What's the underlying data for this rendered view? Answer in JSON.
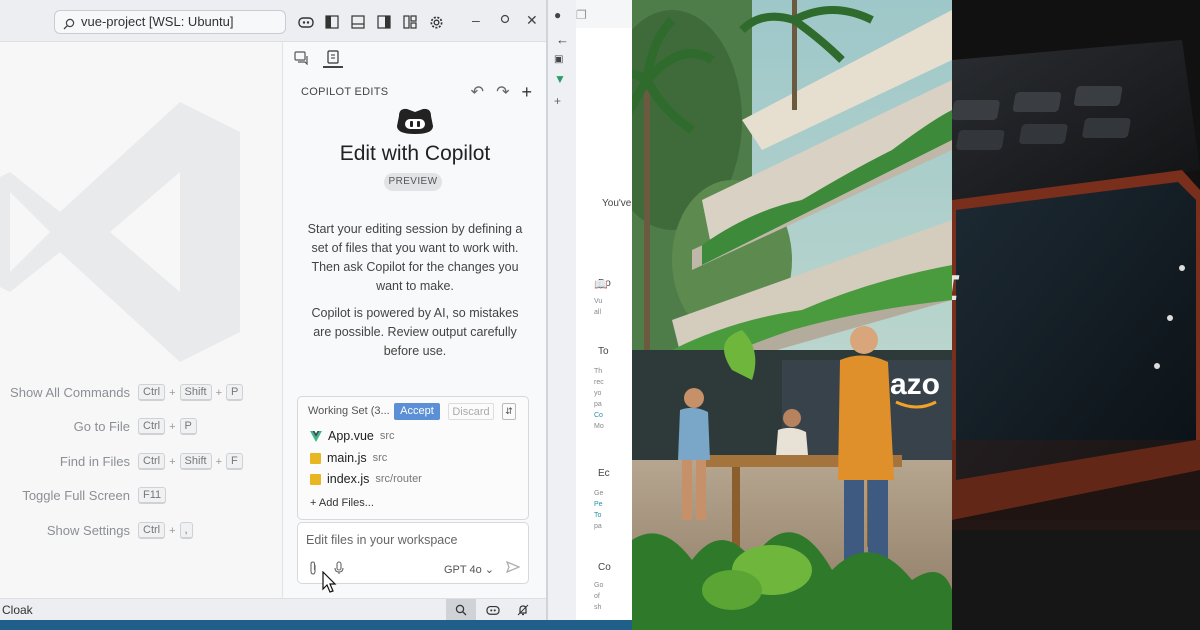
{
  "window": {
    "search_text": "vue-project [WSL: Ubuntu]"
  },
  "shortcuts": [
    {
      "label": "Show All Commands",
      "keys": [
        "Ctrl",
        "Shift",
        "P"
      ]
    },
    {
      "label": "Go to File",
      "keys": [
        "Ctrl",
        "P"
      ]
    },
    {
      "label": "Find in Files",
      "keys": [
        "Ctrl",
        "Shift",
        "F"
      ]
    },
    {
      "label": "Toggle Full Screen",
      "keys": [
        "F11"
      ]
    },
    {
      "label": "Show Settings",
      "keys": [
        "Ctrl",
        ","
      ]
    }
  ],
  "copilot": {
    "header": "COPILOT EDITS",
    "title": "Edit with Copilot",
    "badge": "PREVIEW",
    "intro_lines": [
      "Start your editing session by defining a",
      "set of files that you want to work with.",
      "Then ask Copilot for the changes you",
      "want to make."
    ],
    "warning_lines": [
      "Copilot is powered by AI, so mistakes",
      "are possible. Review output carefully",
      "before use."
    ],
    "working_set": {
      "label": "Working Set (3...",
      "accept": "Accept",
      "discard": "Discard",
      "files": [
        {
          "name": "App.vue",
          "path": "src",
          "icon": "vue-icon"
        },
        {
          "name": "main.js",
          "path": "src",
          "icon": "js-icon"
        },
        {
          "name": "index.js",
          "path": "src/router",
          "icon": "js-icon"
        }
      ],
      "add_files": "+ Add Files..."
    },
    "input": {
      "placeholder": "Edit files in your workspace",
      "model": "GPT 4o ⌄"
    }
  },
  "statusbar": {
    "text": "Cloak"
  },
  "browser": {
    "fragment_1": "You've",
    "fragment_2": "Do",
    "fragment_3": "To",
    "fragment_4": "Ec",
    "fragment_5": "Co"
  },
  "scene": {
    "sign_text": "azo"
  },
  "photo": {
    "screen_text": "AI"
  },
  "colors": {
    "accept_bg": "#5b8fd6",
    "statusbar_bg": "#eceef1",
    "panel_bg": "#f8f9fa"
  }
}
